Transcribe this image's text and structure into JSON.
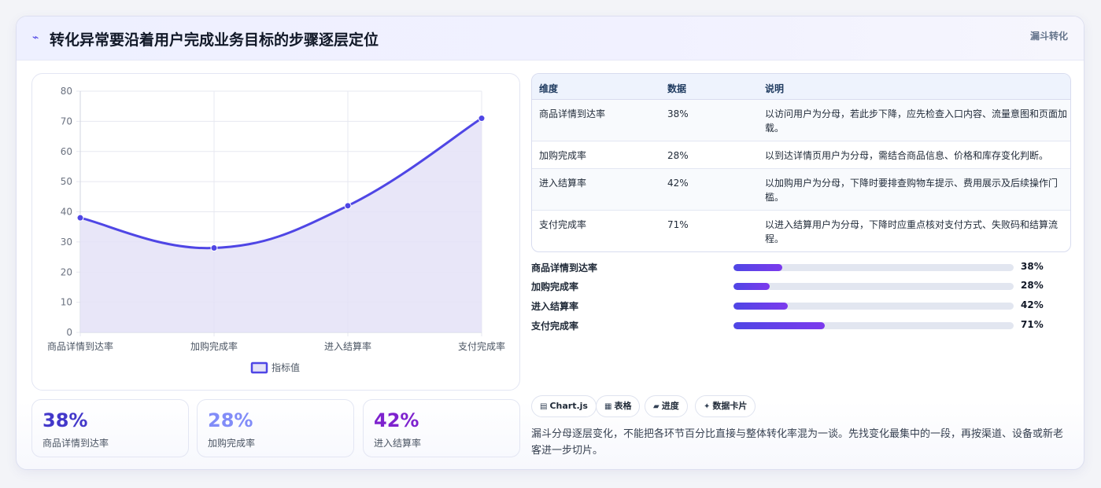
{
  "header": {
    "icon": "⌁",
    "title": "转化异常要沿着用户完成业务目标的步骤逐层定位",
    "tag": "漏斗转化"
  },
  "chart_data": {
    "type": "line",
    "categories": [
      "商品详情到达率",
      "加购完成率",
      "进入结算率",
      "支付完成率"
    ],
    "series": [
      {
        "name": "指标值",
        "values": [
          38,
          28,
          42,
          71
        ]
      }
    ],
    "ylim": [
      0,
      80
    ],
    "yticks": [
      0,
      10,
      20,
      30,
      40,
      50,
      60,
      70,
      80
    ],
    "fill": true,
    "smooth": true,
    "legend_position": "bottom",
    "colors": {
      "line": "#4f46e5",
      "fill": "#e4e2f7",
      "grid": "#e7e8f0"
    }
  },
  "stats": [
    {
      "value": "38%",
      "label": "商品详情到达率",
      "color": "#4338ca"
    },
    {
      "value": "28%",
      "label": "加购完成率",
      "color": "#818cf8"
    },
    {
      "value": "42%",
      "label": "进入结算率",
      "color": "#7e22ce"
    }
  ],
  "table": {
    "headers": [
      "维度",
      "数据",
      "说明"
    ],
    "rows": [
      {
        "dim": "商品详情到达率",
        "val": "38%",
        "desc": "以访问用户为分母，若此步下降，应先检查入口内容、流量意图和页面加载。"
      },
      {
        "dim": "加购完成率",
        "val": "28%",
        "desc": "以到达详情页用户为分母，需结合商品信息、价格和库存变化判断。"
      },
      {
        "dim": "进入结算率",
        "val": "42%",
        "desc": "以加购用户为分母，下降时要排查购物车提示、费用展示及后续操作门槛。"
      },
      {
        "dim": "支付完成率",
        "val": "71%",
        "desc": "以进入结算用户为分母，下降时应重点核对支付方式、失败码和结算流程。"
      }
    ]
  },
  "progress": [
    {
      "label": "商品详情到达率",
      "value": 38,
      "text": "38%"
    },
    {
      "label": "加购完成率",
      "value": 28,
      "text": "28%"
    },
    {
      "label": "进入结算率",
      "value": 42,
      "text": "42%"
    },
    {
      "label": "支付完成率",
      "value": 71,
      "text": "71%"
    }
  ],
  "chips": [
    {
      "icon": "▤",
      "label": "Chart.js"
    },
    {
      "icon": "▦",
      "label": "表格"
    },
    {
      "icon": "▰",
      "label": "进度"
    },
    {
      "icon": "✦",
      "label": "数据卡片"
    }
  ],
  "footnote": "漏斗分母逐层变化，不能把各环节百分比直接与整体转化率混为一谈。先找变化最集中的一段，再按渠道、设备或新老客进一步切片。"
}
